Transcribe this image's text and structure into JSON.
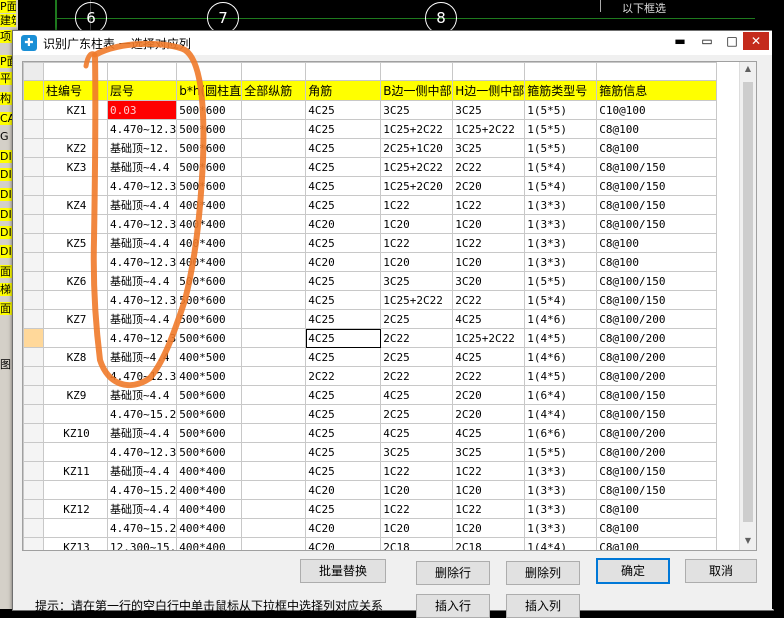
{
  "background": {
    "axis_labels": [
      "6",
      "7",
      "8"
    ],
    "top_right_label": "以下框选",
    "left_panel_items": [
      "P面图",
      "建筑平",
      "项",
      "P面",
      "平",
      "构",
      "CA",
      "G",
      "DI",
      "DI",
      "DI",
      "DI",
      "DI",
      "DI",
      "面",
      "梯",
      "面",
      "图"
    ]
  },
  "dialog": {
    "title": "识别广东柱表 一选择对应列",
    "window_buttons": {
      "minimize": "▬",
      "restore": "▭",
      "maximize": "□",
      "close": "✕"
    },
    "columns": [
      "柱编号",
      "层号",
      "b*h(圆柱直",
      "全部纵筋",
      "角筋",
      "B边一侧中部",
      "H边一侧中部",
      "箍筋类型号",
      "箍筋信息"
    ],
    "rows": [
      [
        "KZ1",
        "0.03",
        "500*600",
        "",
        "4C25",
        "3C25",
        "3C25",
        "1(5*5)",
        "C10@100"
      ],
      [
        "",
        "4.470~12.3",
        "500*600",
        "",
        "4C25",
        "1C25+2C22",
        "1C25+2C22",
        "1(5*5)",
        "C8@100"
      ],
      [
        "KZ2",
        "基础顶~12.",
        "500*600",
        "",
        "4C25",
        "2C25+1C20",
        "3C25",
        "1(5*5)",
        "C8@100"
      ],
      [
        "KZ3",
        "基础顶~4.4",
        "500*600",
        "",
        "4C25",
        "1C25+2C22",
        "2C22",
        "1(5*4)",
        "C8@100/150"
      ],
      [
        "",
        "4.470~12.3",
        "500*600",
        "",
        "4C25",
        "1C25+2C20",
        "2C20",
        "1(5*4)",
        "C8@100/150"
      ],
      [
        "KZ4",
        "基础顶~4.4",
        "400*400",
        "",
        "4C25",
        "1C22",
        "1C22",
        "1(3*3)",
        "C8@100/150"
      ],
      [
        "",
        "4.470~12.3",
        "400*400",
        "",
        "4C20",
        "1C20",
        "1C20",
        "1(3*3)",
        "C8@100/150"
      ],
      [
        "KZ5",
        "基础顶~4.4",
        "400*400",
        "",
        "4C25",
        "1C22",
        "1C22",
        "1(3*3)",
        "C8@100"
      ],
      [
        "",
        "4.470~12.3",
        "400*400",
        "",
        "4C20",
        "1C20",
        "1C20",
        "1(3*3)",
        "C8@100"
      ],
      [
        "KZ6",
        "基础顶~4.4",
        "500*600",
        "",
        "4C25",
        "3C25",
        "3C20",
        "1(5*5)",
        "C8@100/150"
      ],
      [
        "",
        "4.470~12.3",
        "500*600",
        "",
        "4C25",
        "1C25+2C22",
        "2C22",
        "1(5*4)",
        "C8@100/150"
      ],
      [
        "KZ7",
        "基础顶~4.4",
        "500*600",
        "",
        "4C25",
        "2C25",
        "4C25",
        "1(4*6)",
        "C8@100/200"
      ],
      [
        "",
        "4.470~12.3",
        "500*600",
        "",
        "4C25",
        "2C22",
        "1C25+2C22",
        "1(4*5)",
        "C8@100/200"
      ],
      [
        "KZ8",
        "基础顶~4.4",
        "400*500",
        "",
        "4C25",
        "2C25",
        "4C25",
        "1(4*6)",
        "C8@100/200"
      ],
      [
        "",
        "4.470~12.3",
        "400*500",
        "",
        "2C22",
        "2C22",
        "2C22",
        "1(4*5)",
        "C8@100/200"
      ],
      [
        "KZ9",
        "基础顶~4.4",
        "500*600",
        "",
        "4C25",
        "4C25",
        "2C20",
        "1(6*4)",
        "C8@100/150"
      ],
      [
        "",
        "4.470~15.2",
        "500*600",
        "",
        "4C25",
        "2C25",
        "2C20",
        "1(4*4)",
        "C8@100/150"
      ],
      [
        "KZ10",
        "基础顶~4.4",
        "500*600",
        "",
        "4C25",
        "4C25",
        "4C25",
        "1(6*6)",
        "C8@100/200"
      ],
      [
        "",
        "4.470~12.3",
        "500*600",
        "",
        "4C25",
        "3C25",
        "3C25",
        "1(5*5)",
        "C8@100/200"
      ],
      [
        "KZ11",
        "基础顶~4.4",
        "400*400",
        "",
        "4C25",
        "1C22",
        "1C22",
        "1(3*3)",
        "C8@100/150"
      ],
      [
        "",
        "4.470~15.2",
        "400*400",
        "",
        "4C20",
        "1C20",
        "1C20",
        "1(3*3)",
        "C8@100/150"
      ],
      [
        "KZ12",
        "基础顶~4.4",
        "400*400",
        "",
        "4C25",
        "1C22",
        "1C22",
        "1(3*3)",
        "C8@100"
      ],
      [
        "",
        "4.470~15.2",
        "400*400",
        "",
        "4C20",
        "1C20",
        "1C20",
        "1(3*3)",
        "C8@100"
      ],
      [
        "KZ13",
        "12.300~15.",
        "400*400",
        "",
        "4C20",
        "2C18",
        "2C18",
        "1(4*4)",
        "C8@100"
      ]
    ],
    "buttons": {
      "batch_replace": "批量替换",
      "delete_row": "删除行",
      "delete_col": "删除列",
      "ok": "确定",
      "cancel": "取消",
      "insert_row": "插入行",
      "insert_col": "插入列"
    },
    "hint": "提示：请在第一行的空白行中单击鼠标从下拉框中选择列对应关系"
  },
  "colors": {
    "header_yellow": "#ffff00",
    "highlight_red": "#ff0000",
    "annotation_orange": "#f07a2a"
  }
}
